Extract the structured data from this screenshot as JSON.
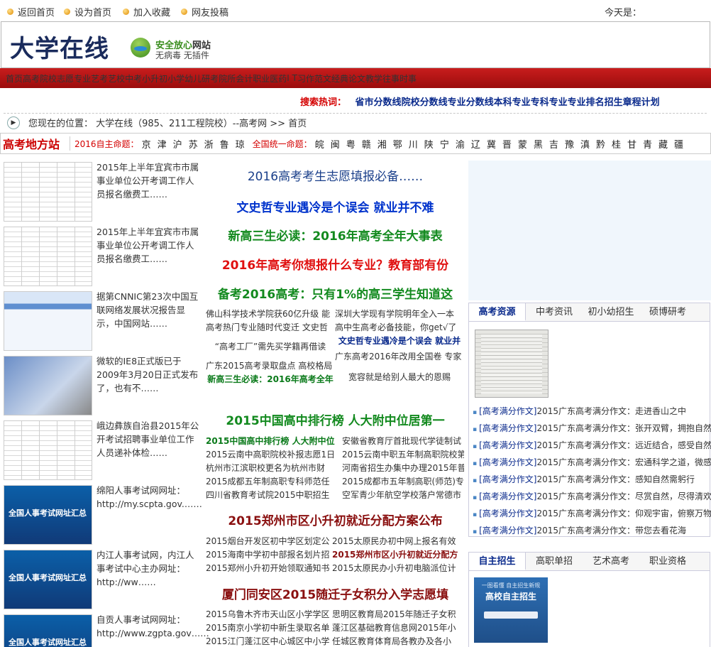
{
  "topbar": {
    "links": [
      "返回首页",
      "设为首页",
      "加入收藏",
      "网友投稿"
    ],
    "today": "今天是："
  },
  "header": {
    "logo": "大学在线",
    "safe_line1_green": "安全放心",
    "safe_line1_black": "网站",
    "safe_line2": "无病毒 无插件"
  },
  "nav": [
    "首页",
    "高考",
    "院校",
    "志愿",
    "专业",
    "艺考",
    "艺校",
    "中考",
    "小升初",
    "小学",
    "幼儿",
    "研考",
    "院所",
    "会计",
    "职业",
    "医药",
    "I T",
    "习作",
    "范文",
    "经典",
    "论文",
    "教学",
    "往事",
    "时事"
  ],
  "hot": {
    "label": "搜索热词：",
    "items": [
      "省市分数线",
      "院校分数线",
      "专业分数线",
      "本科专业",
      "专科专业",
      "专业排名",
      "招生章程",
      "计划"
    ]
  },
  "location": {
    "text": "您现在的位置： 大学在线（985、211工程院校）--高考网 >> 首页"
  },
  "region": {
    "title": "高考地方站",
    "self_label": "2016自主命题：",
    "self_provinces": [
      "京",
      "津",
      "沪",
      "苏",
      "浙",
      "鲁",
      "琼"
    ],
    "unified_label": "全国统一命题：",
    "unified_provinces": [
      "皖",
      "闽",
      "粤",
      "赣",
      "湘",
      "鄂",
      "川",
      "陕",
      "宁",
      "渝",
      "辽",
      "冀",
      "晋",
      "蒙",
      "黑",
      "吉",
      "豫",
      "滇",
      "黔",
      "桂",
      "甘",
      "青",
      "藏",
      "疆"
    ]
  },
  "left_list": [
    {
      "text": "2015年上半年宜宾市市属事业单位公开考调工作人员报名缴费工……",
      "thumb": "table"
    },
    {
      "text": "2015年上半年宜宾市市属事业单位公开考调工作人员报名缴费工……",
      "thumb": "table"
    },
    {
      "text": "据第CNNIC第23次中国互联网络发展状况报告显示，中国网站……",
      "thumb": "screen"
    },
    {
      "text": "微软的IE8正式版已于2009年3月20日正式发布了，也有不……",
      "thumb": "screen2"
    },
    {
      "text": "峨边彝族自治县2015年公开考试招聘事业单位工作人员递补体检……",
      "thumb": "table"
    },
    {
      "text": "绵阳人事考试网网址：http://my.scpta.gov.……",
      "thumb": "poster"
    },
    {
      "text": "内江人事考试网，内江人事考试中心主办网址：http://ww……",
      "thumb": "poster"
    },
    {
      "text": "自贡人事考试网网址：http://www.zgpta.gov……",
      "thumb": "poster"
    }
  ],
  "center": {
    "head1": "2016高考考生志愿填报必备……",
    "head2": "文史哲专业遇冷是个误会 就业并不难",
    "head3": "新高三生必读：2016年高考全年大事表",
    "head4": "2016年高考你想报什么专业？教育部有份",
    "head5": "备考2016高考：只有1%的高三学生知道这",
    "block1_left": [
      "佛山科学技术学院获60亿升级 能",
      "高考热门专业随时代变迁 文史哲",
      "“高考工厂”需先买学籍再借读",
      "广东2015高考录取盘点 高校格局"
    ],
    "block1_left_hl": "新高三生必读：2016年高考全年",
    "block1_right": [
      "深圳大学现有学院明年全入一本",
      "高中生高考必备技能，你get√了"
    ],
    "block1_right_hl": "文史哲专业遇冷是个误会 就业并",
    "block1_right2": [
      "广东高考2016年改用全国卷 专家",
      "宽容就是给别人最大的恩赐"
    ],
    "head6": "2015中国高中排行榜 人大附中位居第一",
    "block2_left_hl": "2015中国高中排行榜 人大附中位",
    "block2_left": [
      "2015云南中高职院校补报志愿1日",
      "杭州市江滨职校更名为杭州市财",
      "2015成都五年制高职专科师范任",
      "四川省教育考试院2015中职招生"
    ],
    "block2_right": [
      "安徽省教育厅首批现代学徒制试",
      "2015云南中职五年制高职院校第",
      "河南省招生办集中办理2015年普",
      "2015成都市五年制高职(师范)专",
      "空军青少年航空学校落户常德市"
    ],
    "head7": "2015郑州市区小升初就近分配方案公布",
    "block3_left": [
      "2015烟台开发区初中学区划定公",
      "2015海南中学初中部报名划片招",
      "2015郑州小升初开始领取通知书"
    ],
    "block3_right": [
      "2015太原民办初中网上报名有效"
    ],
    "block3_right_hl": "2015郑州市区小升初就近分配方",
    "block3_right2": [
      "2015太原民办小升初电脑派位计"
    ],
    "head8": "厦门同安区2015随迁子女积分入学志愿填",
    "block4_left": [
      "2015乌鲁木齐市天山区小学学区",
      "2015南京小学初中新生录取名单",
      "2015江门蓬江区中心城区中小学"
    ],
    "block4_right": [
      "思明区教育局2015年随迁子女积",
      "蓬江区基础教育信息网2015年小",
      "任城区教育体育局各教办及各小"
    ]
  },
  "right_tabs1": [
    "高考资源",
    "中考资讯",
    "初小幼招生",
    "硕博研考"
  ],
  "right_list": [
    {
      "cat": "[高考满分作文]",
      "text": "2015广东高考满分作文：走进香山之中"
    },
    {
      "cat": "[高考满分作文]",
      "text": "2015广东高考满分作文：张开双臂，拥抱自然"
    },
    {
      "cat": "[高考满分作文]",
      "text": "2015广东高考满分作文：远近结合，感受自然"
    },
    {
      "cat": "[高考满分作文]",
      "text": "2015广东高考满分作文：宏通科学之道，微感"
    },
    {
      "cat": "[高考满分作文]",
      "text": "2015广东高考满分作文：感知自然需躬行"
    },
    {
      "cat": "[高考满分作文]",
      "text": "2015广东高考满分作文：尽赏自然，尽得清欢"
    },
    {
      "cat": "[高考满分作文]",
      "text": "2015广东高考满分作文：仰观宇宙，俯察万物"
    },
    {
      "cat": "[高考满分作文]",
      "text": "2015广东高考满分作文：带您去看花海"
    }
  ],
  "right_tabs2": [
    "自主招生",
    "高职单招",
    "艺术高考",
    "职业资格"
  ],
  "zz_img": {
    "line1": "一图看懂 自主招生新规",
    "line2": "高校自主招生"
  }
}
